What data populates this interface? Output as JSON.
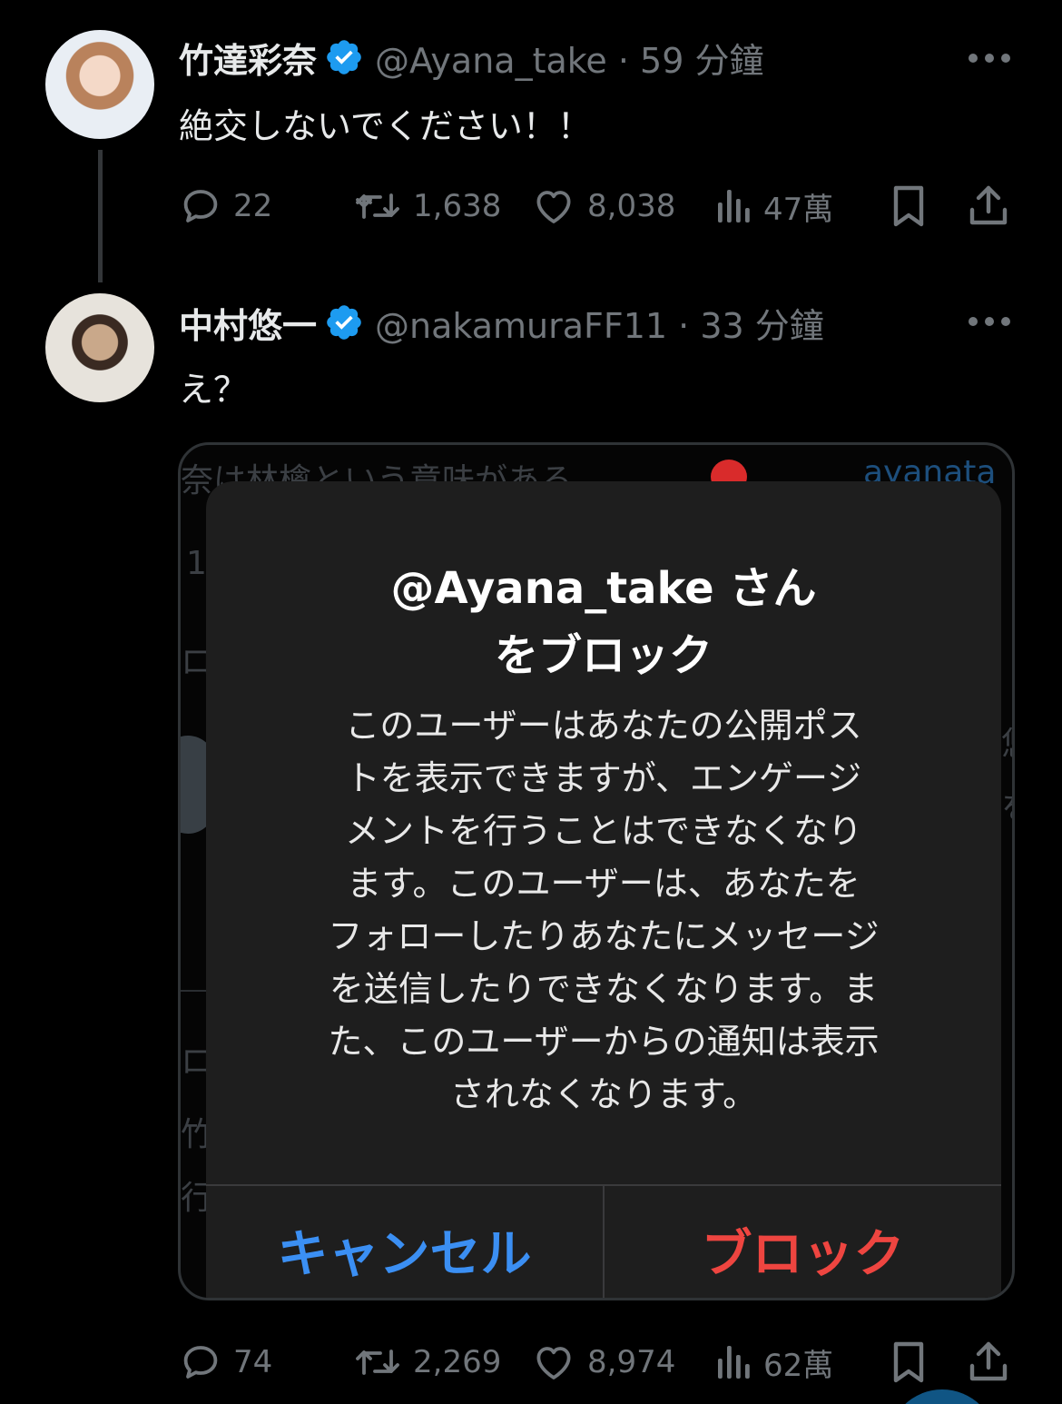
{
  "posts": [
    {
      "display_name": "竹達彩奈",
      "handle_time": "@Ayana_take · 59 分鐘",
      "text": "絶交しないでください！！",
      "stats": {
        "replies": "22",
        "reposts": "1,638",
        "likes": "8,038",
        "views": "47萬"
      }
    },
    {
      "display_name": "中村悠一",
      "handle_time": "@nakamuraFF11 · 33 分鐘",
      "text": "え？",
      "stats": {
        "replies": "74",
        "reposts": "2,269",
        "likes": "8,974",
        "views": "62萬"
      }
    }
  ],
  "embedded_image": {
    "background_fragments": {
      "s1": "奈は林檎という意味がある",
      "s2": "ayanata",
      "s3": "1",
      "s4": "ロ",
      "s5": "ロ",
      "s6": "竹達",
      "s7": "行",
      "s8": "悠",
      "s9": "を"
    },
    "alert": {
      "title_line1": "@Ayana_take さん",
      "title_line2": "をブロック",
      "message_lines": [
        "このユーザーはあなたの公開ポス",
        "トを表示できますが、エンゲージ",
        "メントを行うことはできなくなり",
        "ます。このユーザーは、あなたを",
        "フォローしたりあなたにメッセージ",
        "を送信したりできなくなります。ま",
        "た、このユーザーからの通知は表示",
        "されなくなります。"
      ],
      "cancel_label": "キャンセル",
      "block_label": "ブロック"
    }
  },
  "colors": {
    "background": "#000000",
    "text_primary": "#e7e9ea",
    "text_secondary": "#71767b",
    "verified_badge": "#1d9bf0",
    "alert_cancel": "#3b8ff3",
    "alert_block": "#ee4540"
  },
  "icons": [
    "verified-badge-icon",
    "more-icon",
    "reply-icon",
    "repost-icon",
    "like-icon",
    "views-icon",
    "bookmark-icon",
    "share-icon"
  ]
}
